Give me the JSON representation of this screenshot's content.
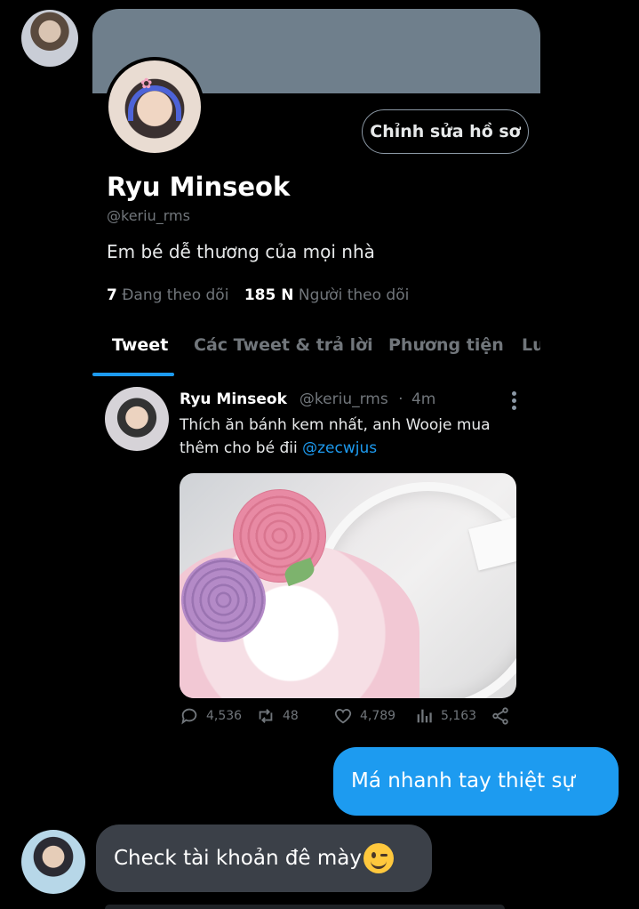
{
  "profile": {
    "edit_button": "Chỉnh sửa hồ sơ",
    "name": "Ryu Minseok",
    "handle": "@keriu_rms",
    "bio": "Em bé dễ thương của mọi nhà",
    "following_count": "7",
    "following_label": "Đang theo dõi",
    "followers_count": "185 N",
    "followers_label": "Người theo dõi"
  },
  "tabs": [
    {
      "label": "Tweet",
      "active": true
    },
    {
      "label": "Các Tweet & trả lời",
      "active": false
    },
    {
      "label": "Phương tiện",
      "active": false
    },
    {
      "label": "Lu",
      "active": false
    }
  ],
  "tweet": {
    "author_name": "Ryu Minseok",
    "author_handle": "@keriu_rms",
    "separator": "·",
    "time": "4m",
    "text": "Thích ăn bánh kem nhất, anh Wooje mua thêm cho bé đii ",
    "mention": "@zecwjus",
    "stats": {
      "replies": "4,536",
      "retweets": "48",
      "likes": "4,789",
      "views": "5,163"
    }
  },
  "messages": {
    "outgoing": "Má nhanh tay thiệt sự",
    "incoming": "Check tài khoản đê mày"
  },
  "icons": {
    "reply": "reply-icon",
    "retweet": "retweet-icon",
    "like": "heart-icon",
    "views": "views-icon",
    "share": "share-icon",
    "more": "more-vertical-icon",
    "emoji": "winking-face-emoji"
  },
  "colors": {
    "accent": "#1d9bf0",
    "banner": "#6f7f8c",
    "muted_text": "#71767b",
    "incoming_bubble": "#3b4048"
  }
}
